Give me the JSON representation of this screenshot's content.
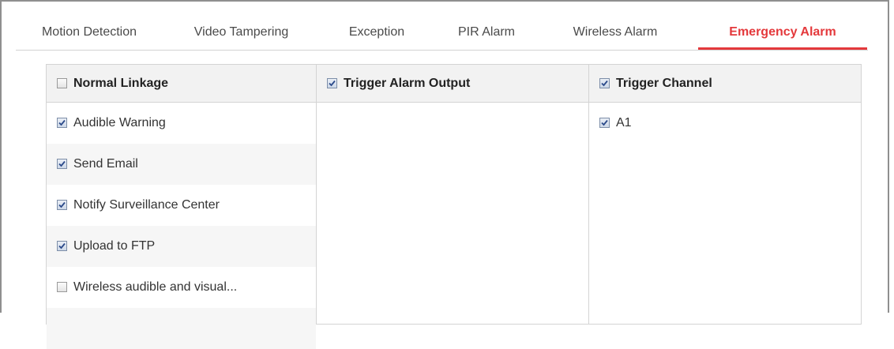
{
  "tabs": [
    {
      "label": "Motion Detection",
      "active": false
    },
    {
      "label": "Video Tampering",
      "active": false
    },
    {
      "label": "Exception",
      "active": false
    },
    {
      "label": "PIR Alarm",
      "active": false
    },
    {
      "label": "Wireless Alarm",
      "active": false
    },
    {
      "label": "Emergency Alarm",
      "active": true
    }
  ],
  "columns": [
    {
      "header": {
        "label": "Normal Linkage",
        "checked": false
      },
      "items": [
        {
          "label": "Audible Warning",
          "checked": true
        },
        {
          "label": "Send Email",
          "checked": true
        },
        {
          "label": "Notify Surveillance Center",
          "checked": true
        },
        {
          "label": "Upload to FTP",
          "checked": true
        },
        {
          "label": "Wireless audible and visual...",
          "checked": false
        }
      ]
    },
    {
      "header": {
        "label": "Trigger Alarm Output",
        "checked": true
      },
      "items": []
    },
    {
      "header": {
        "label": "Trigger Channel",
        "checked": true
      },
      "items": [
        {
          "label": "A1",
          "checked": true
        }
      ]
    }
  ],
  "colors": {
    "accent": "#e4393c",
    "check_mark": "#2b4a8a"
  }
}
